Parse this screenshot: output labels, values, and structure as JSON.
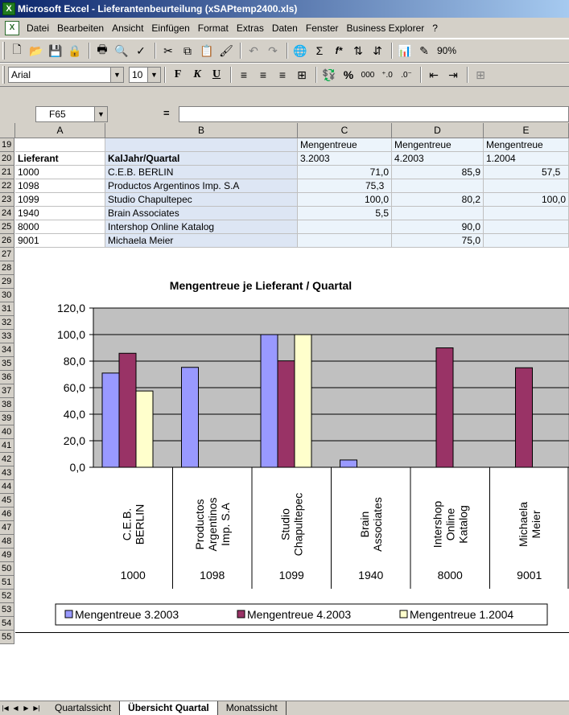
{
  "window": {
    "title": "Microsoft Excel - Lieferantenbeurteilung (xSAPtemp2400.xls)"
  },
  "menu": [
    "Datei",
    "Bearbeiten",
    "Ansicht",
    "Einfügen",
    "Format",
    "Extras",
    "Daten",
    "Fenster",
    "Business Explorer",
    "?"
  ],
  "toolbar": {
    "zoom": "90%",
    "font_name": "Arial",
    "font_size": "10",
    "bold": "F",
    "italic": "K",
    "underline": "U",
    "percent": "%",
    "thousands": "000",
    "sum": "Σ",
    "fx": "f*"
  },
  "formula": {
    "namebox": "F65",
    "eq": "=",
    "content": ""
  },
  "columns": [
    "A",
    "B",
    "C",
    "D",
    "E"
  ],
  "rows": {
    "19": {
      "A": "",
      "B": "",
      "C": "Mengentreue",
      "D": "Mengentreue",
      "E": "Mengentreue"
    },
    "20": {
      "A": "Lieferant",
      "B": "KalJahr/Quartal",
      "C": "3.2003",
      "D": "4.2003",
      "E": "1.2004"
    },
    "21": {
      "A": "1000",
      "B": "C.E.B. BERLIN",
      "C": "71,0",
      "D": "85,9",
      "E": "57,5"
    },
    "22": {
      "A": "1098",
      "B": "Productos Argentinos Imp. S.A",
      "C": "75,3",
      "D": "",
      "E": ""
    },
    "23": {
      "A": "1099",
      "B": "Studio Chapultepec",
      "C": "100,0",
      "D": "80,2",
      "E": "100,0"
    },
    "24": {
      "A": "1940",
      "B": "Brain Associates",
      "C": "5,5",
      "D": "",
      "E": ""
    },
    "25": {
      "A": "8000",
      "B": "Intershop Online Katalog",
      "C": "",
      "D": "90,0",
      "E": ""
    },
    "26": {
      "A": "9001",
      "B": "Michaela Meier",
      "C": "",
      "D": "75,0",
      "E": ""
    }
  },
  "chart_data": {
    "type": "bar",
    "title": "Mengentreue je Lieferant / Quartal",
    "categories": [
      {
        "name": "C.E.B. BERLIN",
        "lines": [
          "C.E.B.",
          "BERLIN"
        ],
        "id": "1000"
      },
      {
        "name": "Productos Argentinos Imp. S.A",
        "lines": [
          "Productos",
          "Argentinos",
          "Imp. S.A"
        ],
        "id": "1098"
      },
      {
        "name": "Studio Chapultepec",
        "lines": [
          "Studio",
          "Chapultepec"
        ],
        "id": "1099"
      },
      {
        "name": "Brain Associates",
        "lines": [
          "Brain",
          "Associates"
        ],
        "id": "1940"
      },
      {
        "name": "Intershop Online Katalog",
        "lines": [
          "Intershop",
          "Online",
          "Katalog"
        ],
        "id": "8000"
      },
      {
        "name": "Michaela Meier",
        "lines": [
          "Michaela",
          "Meier"
        ],
        "id": "9001"
      }
    ],
    "series": [
      {
        "name": "Mengentreue 3.2003",
        "color": "#9999ff",
        "values": [
          71.0,
          75.3,
          100.0,
          5.5,
          null,
          null
        ]
      },
      {
        "name": "Mengentreue 4.2003",
        "color": "#993366",
        "values": [
          85.9,
          null,
          80.2,
          null,
          90.0,
          75.0
        ]
      },
      {
        "name": "Mengentreue 1.2004",
        "color": "#ffffcc",
        "values": [
          57.5,
          null,
          100.0,
          null,
          null,
          null
        ]
      }
    ],
    "yticks": [
      "0,0",
      "20,0",
      "40,0",
      "60,0",
      "80,0",
      "100,0",
      "120,0"
    ],
    "ylim": [
      0,
      120
    ],
    "plot_bg": "#c0c0c0",
    "grid": true,
    "legend_position": "bottom"
  },
  "sheets": [
    {
      "name": "Quartalssicht",
      "active": false
    },
    {
      "name": "Übersicht Quartal",
      "active": true
    },
    {
      "name": "Monatssicht",
      "active": false
    }
  ]
}
